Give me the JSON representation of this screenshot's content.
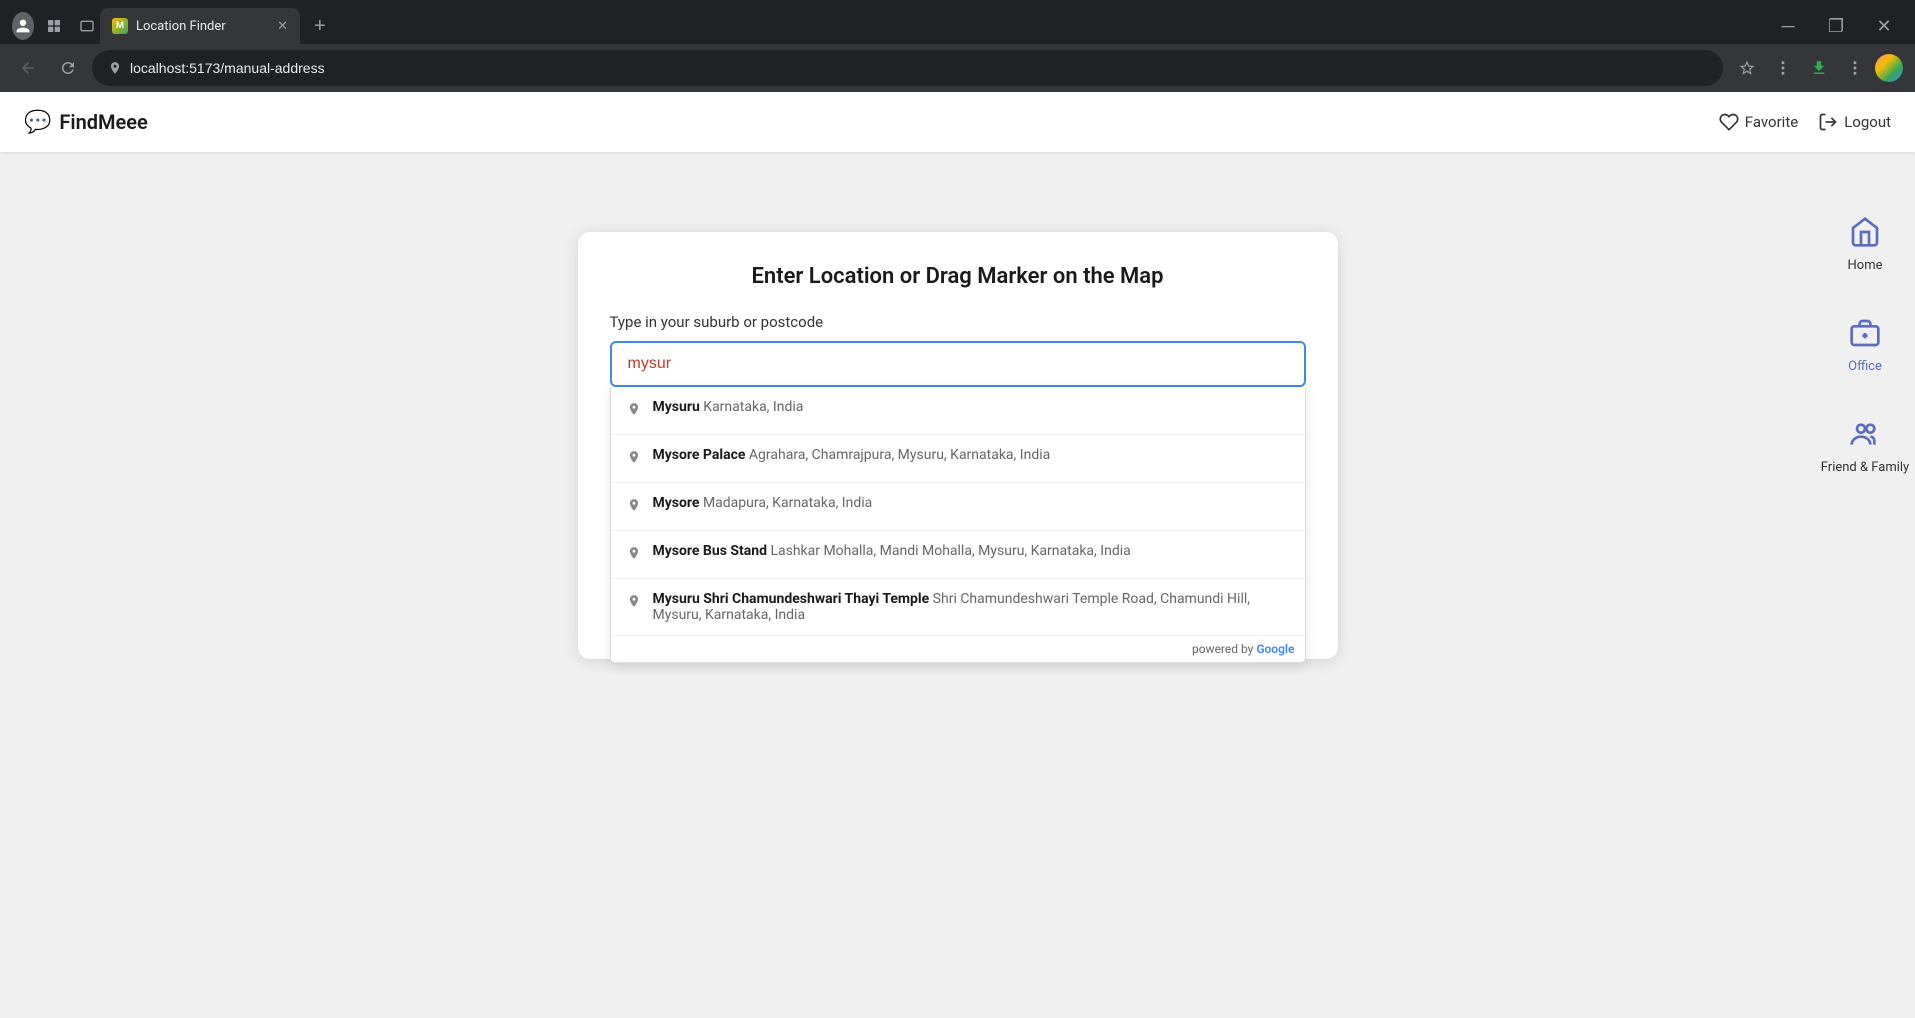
{
  "browser": {
    "tab_title": "Location Finder",
    "url": "localhost:5173/manual-address",
    "favicon_color": "#fbbc04",
    "window_minimize": "–",
    "window_restore": "◻",
    "window_close": "✕"
  },
  "app": {
    "logo": "FindMeee",
    "logo_icon": "💬",
    "nav": {
      "favorite_label": "Favorite",
      "logout_label": "Logout"
    }
  },
  "card": {
    "title": "Enter Location or Drag Marker on the Map",
    "label": "Type in your suburb or postcode",
    "input_value": "mysur",
    "input_placeholder": "Type in your suburb or postcode"
  },
  "suggestions": [
    {
      "bold": "Mysuru",
      "light": " Karnataka, India"
    },
    {
      "bold": "Mysore Palace",
      "light": " Agrahara, Chamrajpura, Mysuru, Karnataka, India"
    },
    {
      "bold": "Mysore",
      "light": " Madapura, Karnataka, India"
    },
    {
      "bold": "Mysore Bus Stand",
      "light": " Lashkar Mohalla, Mandi Mohalla, Mysuru, Karnataka, India"
    },
    {
      "bold": "Mysuru Shri Chamundeshwari Thayi Temple",
      "light": " Shri Chamundeshwari Temple Road, Chamundi Hill, Mysuru, Karnataka, India"
    }
  ],
  "powered_by": "powered by",
  "google_label": "Google",
  "sidebar": {
    "items": [
      {
        "label": "Home",
        "icon": "home"
      },
      {
        "label": "Office",
        "icon": "office"
      },
      {
        "label": "Friend & Family",
        "icon": "friends"
      }
    ]
  }
}
